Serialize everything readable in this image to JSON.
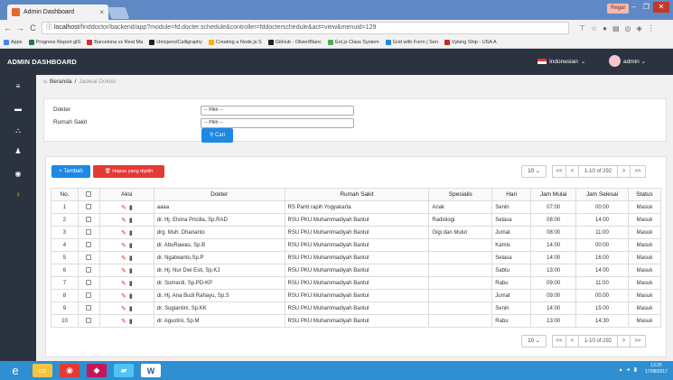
{
  "browser": {
    "tab_title": "Admin Dashboard",
    "tab_close": "×",
    "user_badge": "Regar",
    "url_host": "localhost",
    "url_rest": "/finddoctor/backend/app?module=fd.docter.schedule&controller=fddocterschedule&act=view&menuid=129",
    "bookmarks": [
      "Apps",
      "Progress Report gtS",
      "Barcelona vs Real Ma",
      "chrisjenx/Calligraphy",
      "Creating a Node.js S",
      "GitHub - OlivierBlanc",
      "Ext.js Class System",
      "Grid with Form | Sen",
      "Vyking Ship - USA A"
    ],
    "bookmark_colors": [
      "#4285f4",
      "#1b7d3f",
      "#d32f2f",
      "#222222",
      "#f4b400",
      "#222222",
      "#4caf50",
      "#1e88e5",
      "#c62828"
    ]
  },
  "header": {
    "brand": "ADMIN DASHBOARD",
    "language": "Indonesian",
    "user": "admin"
  },
  "breadcrumb": {
    "home": "Beranda",
    "sep": "/",
    "current": "Jadwal Dokter"
  },
  "filter": {
    "doctor_label": "Dokter",
    "hospital_label": "Rumah Sakit",
    "doctor_value": "-- Pilih --",
    "hospital_value": "-- Pilih --",
    "search_button": "Cari"
  },
  "toolbar": {
    "add_button": "Tambah",
    "delete_button": "Hapus yang dipilih",
    "per_page": "10",
    "pager_first": "<<",
    "pager_prev": "<",
    "pager_info": "1-10 of 292",
    "pager_next": ">",
    "pager_last": ">>"
  },
  "table": {
    "headers": [
      "No.",
      "",
      "Aksi",
      "Dokter",
      "Rumah Sakit",
      "Spesialis",
      "Hari",
      "Jam Mulai",
      "Jam Selesai",
      "Status"
    ],
    "rows": [
      [
        "1",
        "aaaa",
        "RS Panti rapih Yogyakarta",
        "Anak",
        "Senin",
        "07:00",
        "00:00",
        "Masuk"
      ],
      [
        "2",
        "dr. Hj. Elvina Pricilla, Sp.RAD",
        "RSU PKU Muhammadiyah Bantul",
        "Radiologi",
        "Selasa",
        "08:00",
        "14:00",
        "Masuk"
      ],
      [
        "3",
        "drg. Muh. Dhananto",
        "RSU PKU Muhammadiyah Bantul",
        "Gigi dan Mulut",
        "Jumat",
        "08:00",
        "11:00",
        "Masuk"
      ],
      [
        "4",
        "dr. AbuRawas, Sp.B",
        "RSU PKU Muhammadiyah Bantul",
        "",
        "Kamis",
        "14:00",
        "00:00",
        "Masuk"
      ],
      [
        "5",
        "dr. Ngatwanto,Sp.P",
        "RSU PKU Muhammadiyah Bantul",
        "",
        "Selasa",
        "14:00",
        "16:00",
        "Masuk"
      ],
      [
        "6",
        "dr. Hj. Nur Dwi Esti, Sp.KJ",
        "RSU PKU Muhammadiyah Bantul",
        "",
        "Sabtu",
        "13:00",
        "14:00",
        "Masuk"
      ],
      [
        "7",
        "dr. Sumardi, Sp.PD-KP",
        "RSU PKU Muhammadiyah Bantul",
        "",
        "Rabu",
        "09:00",
        "11:00",
        "Masuk"
      ],
      [
        "8",
        "dr. Hj. Ana Budi Rahayu, Sp.S",
        "RSU PKU Muhammadiyah Bantul",
        "",
        "Jumat",
        "09:00",
        "00:00",
        "Masuk"
      ],
      [
        "9",
        "dr. Sugiantini, Sp.KK",
        "RSU PKU Muhammadiyah Bantul",
        "",
        "Senin",
        "14:00",
        "15:00",
        "Masuk"
      ],
      [
        "10",
        "dr. Agustini, Sp.M",
        "RSU PKU Muhammadiyah Bantul",
        "",
        "Rabu",
        "13:00",
        "14:30",
        "Masuk"
      ]
    ]
  },
  "taskbar": {
    "time": "13:25",
    "date": "17/08/2017"
  }
}
